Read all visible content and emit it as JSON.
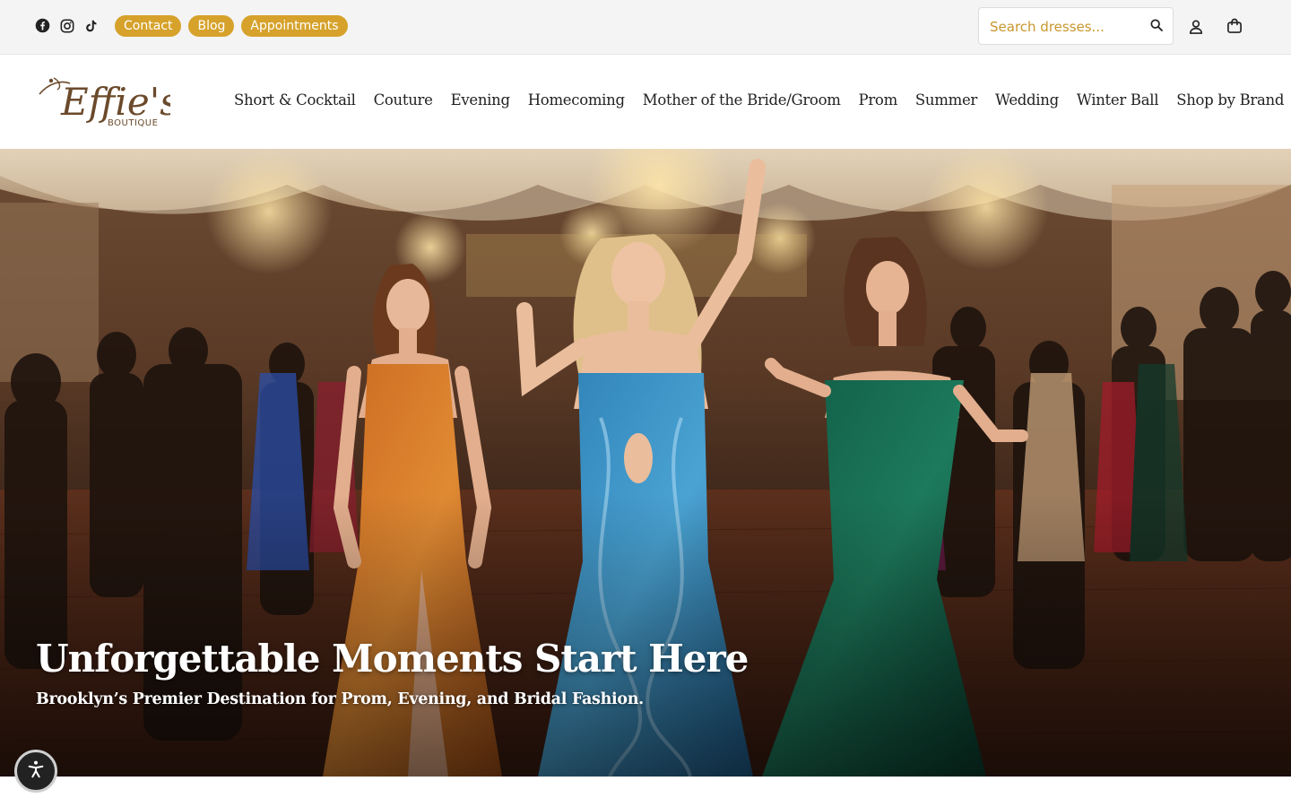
{
  "topbar": {
    "social_icons": [
      "facebook-icon",
      "instagram-icon",
      "tiktok-icon"
    ],
    "links": [
      {
        "label": "Contact"
      },
      {
        "label": "Blog"
      },
      {
        "label": "Appointments"
      }
    ],
    "search": {
      "placeholder": "Search dresses..."
    },
    "icons": [
      "search-icon",
      "account-icon",
      "shopping-bag-icon"
    ]
  },
  "header": {
    "logo_text": "Effie's",
    "logo_subtext": "BOUTIQUE",
    "nav": [
      {
        "label": "Short & Cocktail"
      },
      {
        "label": "Couture"
      },
      {
        "label": "Evening"
      },
      {
        "label": "Homecoming"
      },
      {
        "label": "Mother of the Bride/Groom"
      },
      {
        "label": "Prom"
      },
      {
        "label": "Summer"
      },
      {
        "label": "Wedding"
      },
      {
        "label": "Winter Ball"
      },
      {
        "label": "Shop by Brand"
      }
    ]
  },
  "hero": {
    "title": "Unforgettable Moments Start Here",
    "subtitle": "Brooklyn’s Premier Destination for Prom, Evening, and Bridal Fashion."
  },
  "accessibility": {
    "icon": "accessibility-icon"
  },
  "colors": {
    "accent": "#d6a22b",
    "topbar_bg": "#f4f4f4",
    "logo_brown": "#6b4a2b",
    "text_dark": "#222222"
  }
}
